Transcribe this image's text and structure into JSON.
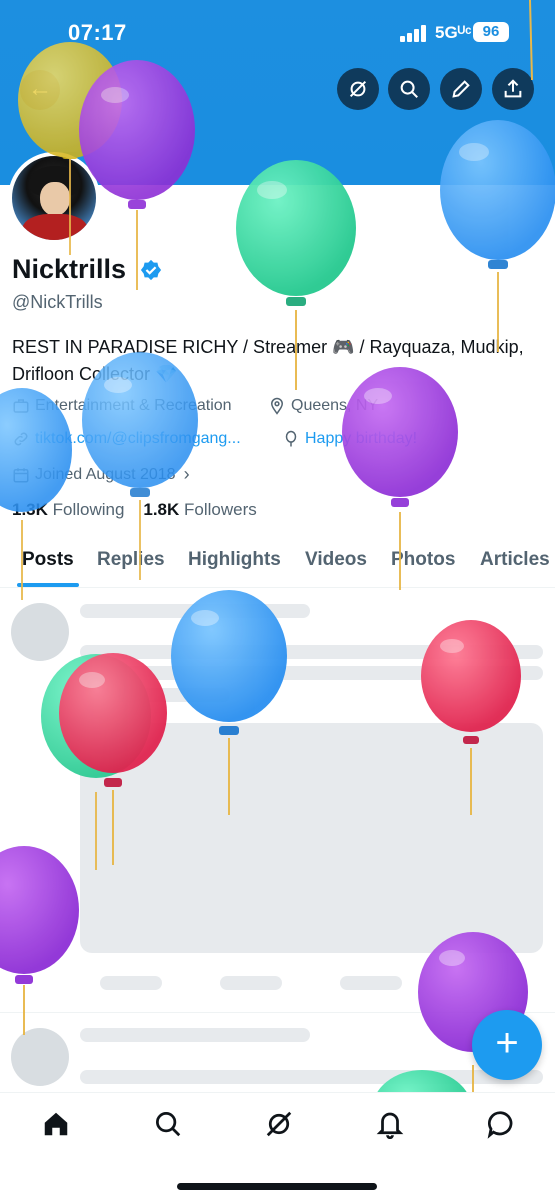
{
  "status": {
    "time": "07:17",
    "network": "5Gᵁᶜ",
    "battery": "96"
  },
  "header": {
    "back_icon": "arrow-left-icon",
    "actions": [
      "grok-icon",
      "search-icon",
      "edit-icon",
      "share-icon"
    ]
  },
  "profile": {
    "display_name": "Nicktrills",
    "handle": "@NickTrills",
    "bio": "REST IN PARADISE RICHY / Streamer 🎮 / Rayquaza, Mudkip, Drifloon Collector 💎",
    "category": "Entertainment & Recreation",
    "location": "Queens, NY",
    "website": "tiktok.com/@clipsfromgang...",
    "birthday": "Happy birthday!",
    "joined": "Joined August 2018",
    "following_count": "1.3K",
    "following_label": "Following",
    "followers_count": "1.8K",
    "followers_label": "Followers"
  },
  "tabs": [
    "Posts",
    "Replies",
    "Highlights",
    "Videos",
    "Photos",
    "Articles"
  ],
  "active_tab": "Posts",
  "fab": {
    "label": "+"
  },
  "bottom_nav": [
    "home-icon",
    "search-icon",
    "grok-icon",
    "bell-icon",
    "messages-icon"
  ],
  "colors": {
    "accent": "#1d9bf0",
    "banner": "#1a8ee0",
    "text": "#0f1419",
    "muted": "#536471"
  }
}
